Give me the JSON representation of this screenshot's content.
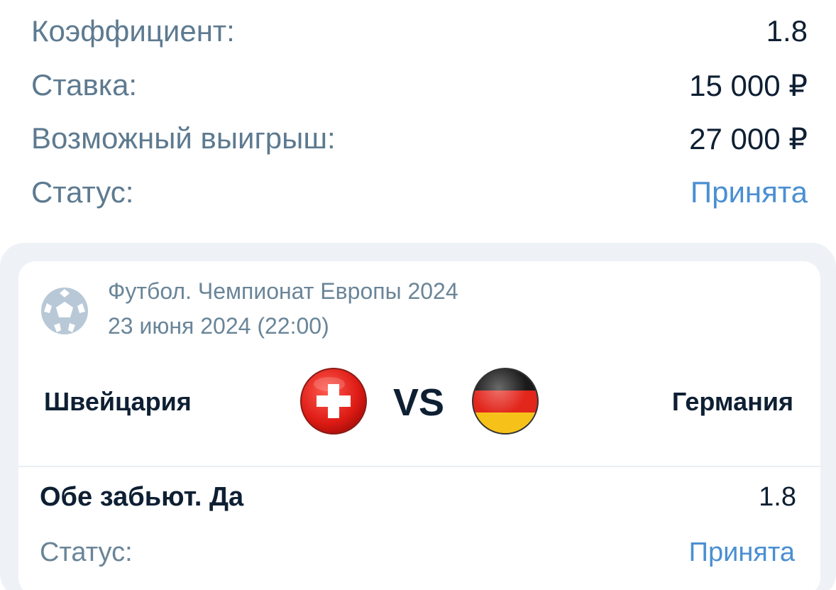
{
  "summary": {
    "coefficient_label": "Коэффициент:",
    "coefficient_value": "1.8",
    "stake_label": "Ставка:",
    "stake_value": "15 000 ₽",
    "win_label": "Возможный выигрыш:",
    "win_value": "27 000 ₽",
    "status_label": "Статус:",
    "status_value": "Принята"
  },
  "event": {
    "sport_icon": "football-icon",
    "title": "Футбол. Чемпионат Европы 2024",
    "date": "23 июня 2024 (22:00)",
    "home_team": "Швейцария",
    "home_flag": "switzerland-flag-icon",
    "vs_label": "VS",
    "away_team": "Германия",
    "away_flag": "germany-flag-icon"
  },
  "outcome": {
    "name": "Обе забьют. Да",
    "odd": "1.8",
    "status_label": "Статус:",
    "status_value": "Принята"
  },
  "colors": {
    "label": "#5d7a90",
    "value": "#0e1f33",
    "accent": "#4a8fd2",
    "panel_bg": "#eef2f6"
  }
}
